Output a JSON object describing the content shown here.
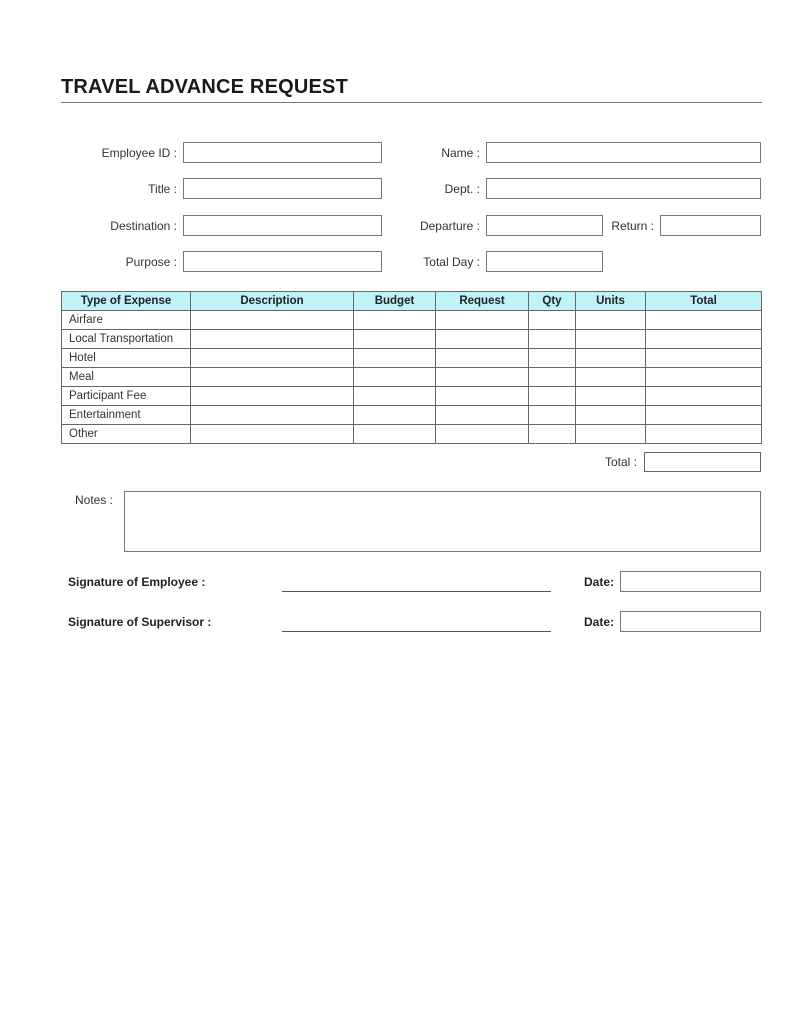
{
  "form": {
    "title": "TRAVEL ADVANCE REQUEST",
    "fields": {
      "employee_id": {
        "label": "Employee ID :",
        "value": ""
      },
      "name": {
        "label": "Name :",
        "value": ""
      },
      "title": {
        "label": "Title :",
        "value": ""
      },
      "dept": {
        "label": "Dept. :",
        "value": ""
      },
      "destination": {
        "label": "Destination :",
        "value": ""
      },
      "departure": {
        "label": "Departure :",
        "value": ""
      },
      "return": {
        "label": "Return :",
        "value": ""
      },
      "purpose": {
        "label": "Purpose :",
        "value": ""
      },
      "total_day": {
        "label": "Total Day :",
        "value": ""
      }
    },
    "expense_table": {
      "header_color": "#bff3f8",
      "columns": [
        "Type of Expense",
        "Description",
        "Budget",
        "Request",
        "Qty",
        "Units",
        "Total"
      ],
      "rows": [
        "Airfare",
        "Local Transportation",
        "Hotel",
        "Meal",
        "Participant Fee",
        "Entertainment",
        "Other"
      ],
      "total_label": "Total :",
      "total_value": ""
    },
    "notes": {
      "label": "Notes :",
      "value": ""
    },
    "signatures": {
      "employee": {
        "label": "Signature of Employee :",
        "date_label": "Date:",
        "date_value": ""
      },
      "supervisor": {
        "label": "Signature of Supervisor :",
        "date_label": "Date:",
        "date_value": ""
      }
    }
  }
}
